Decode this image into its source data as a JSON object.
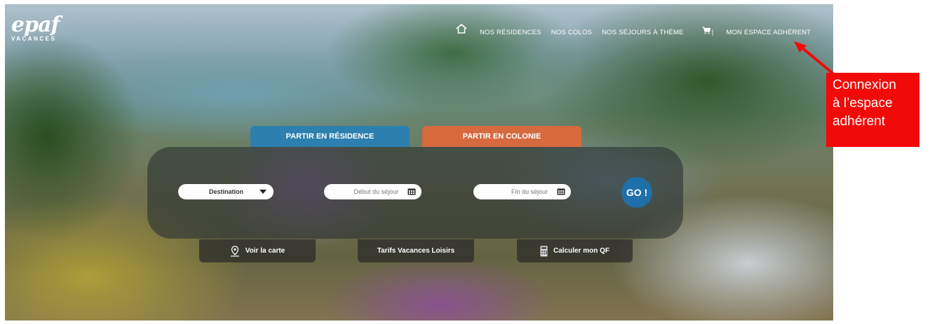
{
  "logo": {
    "mark": "epaf",
    "sub": "VACANCES"
  },
  "nav": {
    "home_icon": "home-icon",
    "items": [
      "NOS RÉSIDENCES",
      "NOS COLOS",
      "NOS SÉJOURS À THÈME"
    ],
    "cart_icon": "cart-icon",
    "separator": "|",
    "member_space": "MON ESPACE ADHÉRENT"
  },
  "tabs": {
    "residence": "PARTIR EN RÉSIDENCE",
    "colonie": "PARTIR EN COLONIE"
  },
  "search": {
    "destination": "Destination",
    "start_placeholder": "Début du séjour",
    "end_placeholder": "Fin du séjour",
    "go": "GO !"
  },
  "buttons": {
    "map": "Voir la carte",
    "tariffs": "Tarifs Vacances Loisirs",
    "qf": "Calculer mon QF"
  },
  "annotation": {
    "line1": "Connexion",
    "line2": "à l’espace",
    "line3": "adhérent"
  },
  "colors": {
    "residence": "#2c7fae",
    "colonie": "#d66a3e",
    "go": "#1f6fa8",
    "annotation": "#f20a0a"
  }
}
